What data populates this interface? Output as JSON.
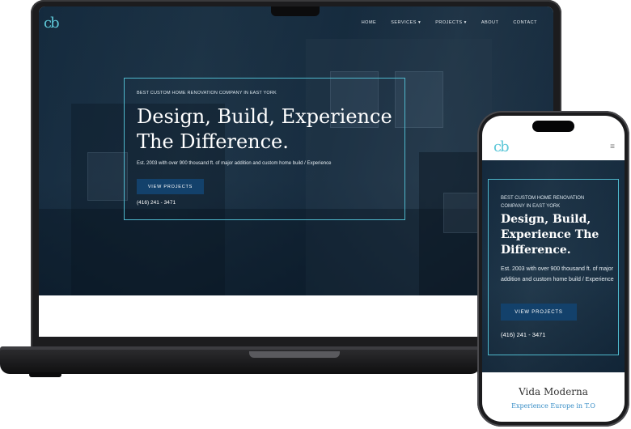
{
  "brand": {
    "logo_text": "cb",
    "accent_color": "#4fb8cc",
    "button_color": "#13416b",
    "link_color": "#3a8fc7"
  },
  "nav": {
    "items": [
      {
        "label": "HOME"
      },
      {
        "label": "SERVICES ▾"
      },
      {
        "label": "PROJECTS ▾"
      },
      {
        "label": "ABOUT"
      },
      {
        "label": "CONTACT"
      }
    ]
  },
  "hero": {
    "eyebrow": "BEST CUSTOM HOME RENOVATION COMPANY IN EAST YORK",
    "title": "Design, Build, Experience The Difference.",
    "subtitle": "Est. 2003 with over 900 thousand ft. of major addition and custom home build / Experience",
    "cta_label": "VIEW PROJECTS",
    "phone": "(416) 241 - 3471"
  },
  "section": {
    "title": "Vida Moderna",
    "subtitle": "Experience Europe in T.O"
  },
  "mobile": {
    "menu_icon": "hamburger-icon"
  }
}
